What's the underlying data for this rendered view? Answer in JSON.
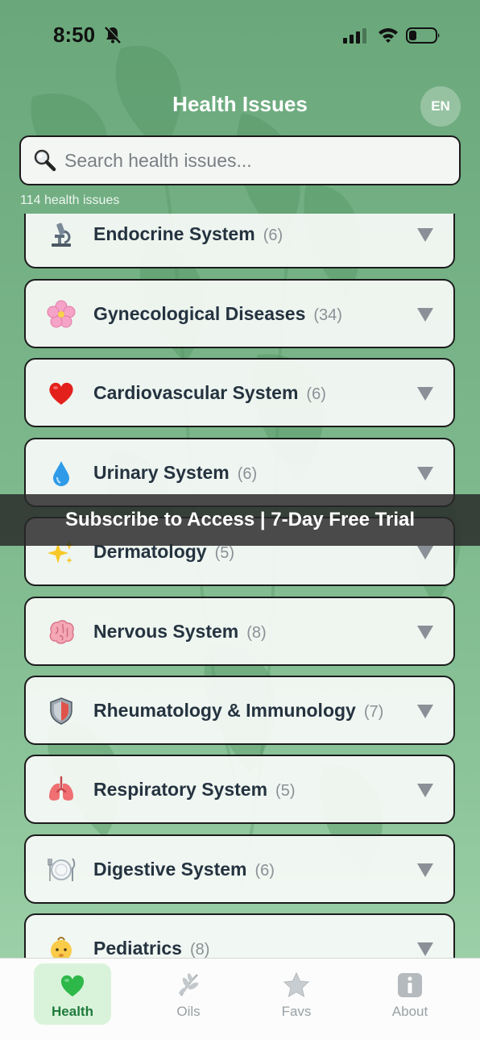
{
  "status_bar": {
    "time": "8:50",
    "icons": [
      "mute-bell-icon",
      "cellular-signal-icon",
      "wifi-icon",
      "battery-icon"
    ]
  },
  "header": {
    "title": "Health Issues",
    "language_button": "EN"
  },
  "search": {
    "placeholder": "Search health issues...",
    "value": "",
    "icon": "magnifier-icon"
  },
  "summary": {
    "count_label": "114 health issues"
  },
  "categories": [
    {
      "name": "Endocrine System",
      "count": "(6)",
      "icon": "microscope-icon"
    },
    {
      "name": "Gynecological Diseases",
      "count": "(34)",
      "icon": "cherry-blossom-icon"
    },
    {
      "name": "Cardiovascular System",
      "count": "(6)",
      "icon": "heart-icon"
    },
    {
      "name": "Urinary System",
      "count": "(6)",
      "icon": "droplet-icon"
    },
    {
      "name": "Dermatology",
      "count": "(5)",
      "icon": "sparkles-icon"
    },
    {
      "name": "Nervous System",
      "count": "(8)",
      "icon": "brain-icon"
    },
    {
      "name": "Rheumatology & Immunology",
      "count": "(7)",
      "icon": "shield-icon"
    },
    {
      "name": "Respiratory System",
      "count": "(5)",
      "icon": "lungs-icon"
    },
    {
      "name": "Digestive System",
      "count": "(6)",
      "icon": "plate-cutlery-icon"
    },
    {
      "name": "Pediatrics",
      "count": "(8)",
      "icon": "baby-icon"
    }
  ],
  "promo_banner": {
    "text": "Subscribe to Access | 7-Day Free Trial"
  },
  "tab_bar": {
    "tabs": [
      {
        "label": "Health",
        "icon": "green-heart-icon",
        "active": true
      },
      {
        "label": "Oils",
        "icon": "herb-icon",
        "active": false
      },
      {
        "label": "Favs",
        "icon": "star-icon",
        "active": false
      },
      {
        "label": "About",
        "icon": "info-icon",
        "active": false
      }
    ]
  },
  "colors": {
    "background_top": "#6aa87b",
    "background_bottom": "#a3d4ad",
    "card_background": "#f8faf8",
    "active_tab_background": "#d9f3db",
    "active_tab_text": "#1f7a3a"
  }
}
